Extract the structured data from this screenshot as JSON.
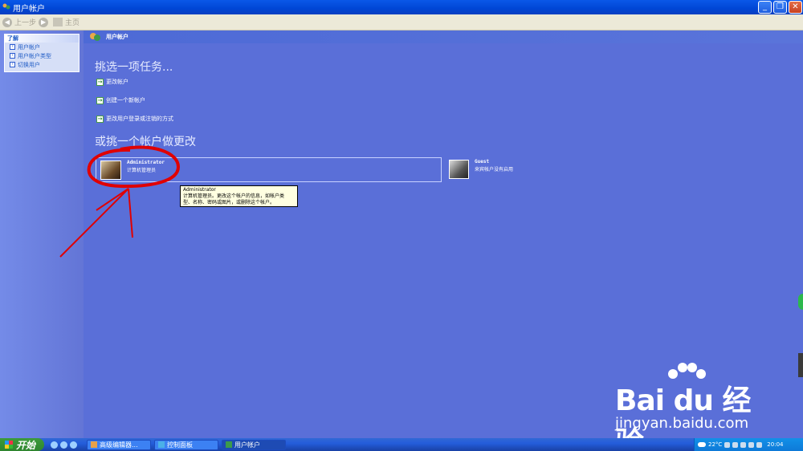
{
  "window": {
    "title": "用户帐户",
    "buttons": {
      "minimize": "_",
      "maximize": "❐",
      "close": "✕"
    }
  },
  "toolbar": {
    "back": "上一步",
    "home": "主页"
  },
  "sidebar": {
    "header": "了解",
    "items": [
      {
        "label": "用户帐户"
      },
      {
        "label": "用户帐户类型"
      },
      {
        "label": "切换用户"
      }
    ]
  },
  "main": {
    "header": "用户帐户",
    "pick_task_title": "挑选一项任务...",
    "tasks": [
      {
        "label": "更改帐户"
      },
      {
        "label": "创建一个新帐户"
      },
      {
        "label": "更改用户登录或注销的方式"
      }
    ],
    "pick_account_title": "或挑一个帐户做更改",
    "accounts": [
      {
        "name": "Administrator",
        "type": "计算机管理员"
      },
      {
        "name": "Guest",
        "type": "来宾帐户没有启用"
      }
    ],
    "tooltip": {
      "line1": "Administrator",
      "line2": "计算机管理员。更改这个帐户的信息，如帐户类",
      "line3": "型、名称、密码或图片，或删除这个帐户。"
    }
  },
  "watermark": {
    "brand": "Bai du 经验",
    "url": "jingyan.baidu.com"
  },
  "taskbar": {
    "start": "开始",
    "items": [
      {
        "label": "高级编辑器..."
      },
      {
        "label": "控制面板"
      },
      {
        "label": "用户帐户"
      }
    ],
    "tray": {
      "temperature": "22°C",
      "time": "20:04"
    }
  },
  "colors": {
    "annotation": "#e00000",
    "desktop": "#5a6fd8",
    "titlebar": "#0046d5"
  }
}
